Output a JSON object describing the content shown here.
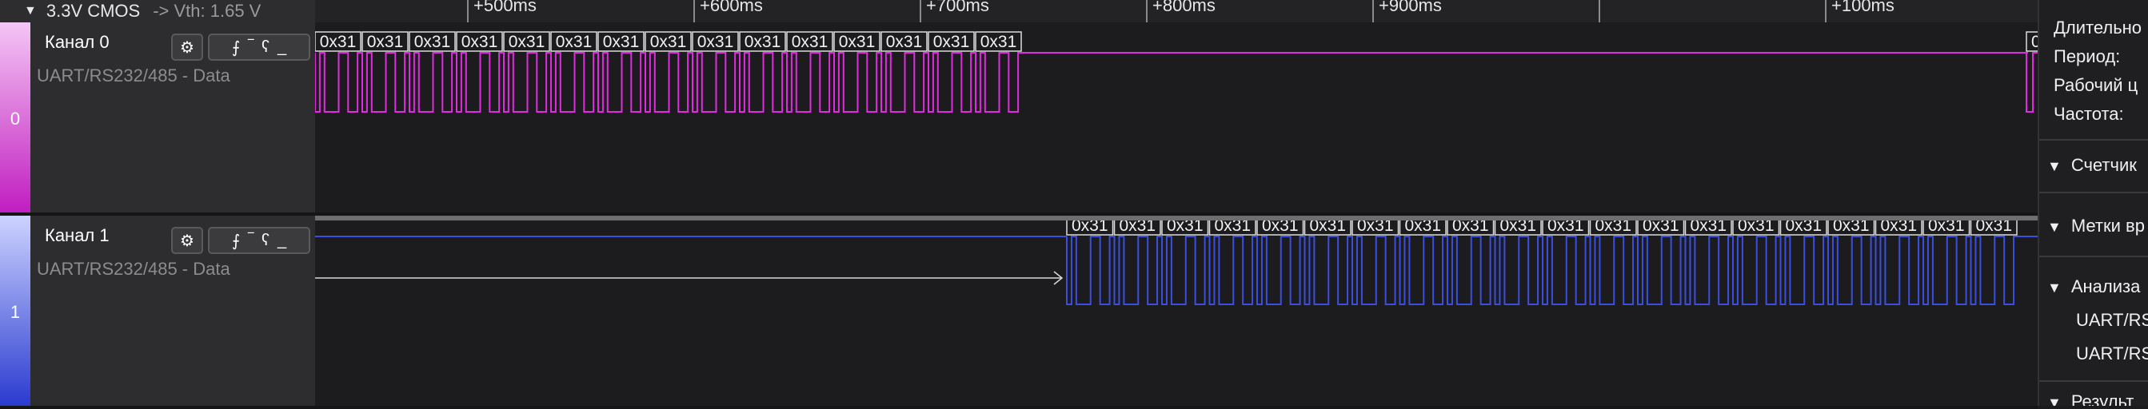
{
  "group": {
    "label": "3.3V CMOS",
    "vth": "-> Vth: 1.65 V"
  },
  "ruler": [
    {
      "label": "+500ms",
      "t": 500
    },
    {
      "label": "+600ms",
      "t": 600
    },
    {
      "label": "+700ms",
      "t": 700
    },
    {
      "label": "+800ms",
      "t": 800
    },
    {
      "label": "+900ms",
      "t": 900
    },
    {
      "label": "",
      "t": 1000
    },
    {
      "label": "+100ms",
      "t": 1100
    }
  ],
  "channels": [
    {
      "name": "Канал 0",
      "index": "0",
      "analyzer": "UART/RS232/485 - Data",
      "color": "#e02be0"
    },
    {
      "name": "Канал 1",
      "index": "1",
      "analyzer": "UART/RS232/485 - Data",
      "color": "#3a4fe0"
    }
  ],
  "frame_label": "0x31",
  "right_panel": {
    "measure_rows": [
      "Длительно",
      "Период:",
      "Рабочий ц",
      "Частота:"
    ],
    "sections": [
      "Счетчик",
      "Метки вр",
      "Анализа"
    ],
    "analyzer_items": [
      "UART/RS",
      "UART/RS"
    ],
    "bottom_section": "Результ"
  },
  "icons": {
    "group_toggle": "triangle-down-icon",
    "settings": "gear-icon",
    "rising_edge": "rising-edge-icon",
    "falling_edge": "falling-edge-icon"
  }
}
